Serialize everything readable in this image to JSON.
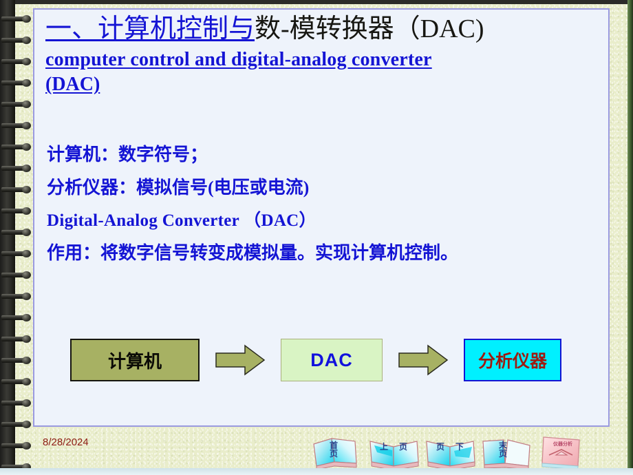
{
  "slide": {
    "title": {
      "line1_blue_underlined": "一、计算机控制与",
      "line1_black": "数-模转换器（DAC)",
      "line2": "computer   control   and   digital-analog   converter",
      "line3": "(DAC)"
    },
    "body": [
      "计算机：数字符号；",
      "分析仪器：模拟信号(电压或电流)",
      "Digital-Analog Converter  （DAC）",
      "作用：将数字信号转变成模拟量。实现计算机控制。"
    ],
    "diagram": {
      "box1": "计算机",
      "box2": "DAC",
      "box3": "分析仪器",
      "arrow1": "arrow-right",
      "arrow2": "arrow-right"
    }
  },
  "footer": {
    "date": "8/28/2024",
    "nav": [
      {
        "name": "first-page",
        "label_top": "首",
        "label_bottom": "页",
        "style": "single"
      },
      {
        "name": "previous-page",
        "label_left": "上",
        "label_right": "页",
        "style": "open"
      },
      {
        "name": "next-page",
        "label_left": "页",
        "label_right": "下",
        "style": "open"
      },
      {
        "name": "last-page",
        "label_top": "末",
        "label_bottom": "页",
        "style": "single"
      },
      {
        "name": "course-home",
        "label": "仪器分析",
        "style": "closed-book"
      }
    ]
  },
  "colors": {
    "background": "#e9edcb",
    "slide_bg": "#eef3fb",
    "slide_border": "#9a9ae0",
    "title_blue": "#1414d4",
    "title_black": "#171712",
    "body_blue": "#1414d4",
    "box1_fill": "#a7b163",
    "box2_fill": "#d9f4c4",
    "box3_fill": "#00f0ff",
    "box3_text": "#9e1b10",
    "arrow_fill": "#a7b163",
    "date_color": "#8d1b12",
    "right_edge_green": "#3d5a2e"
  }
}
